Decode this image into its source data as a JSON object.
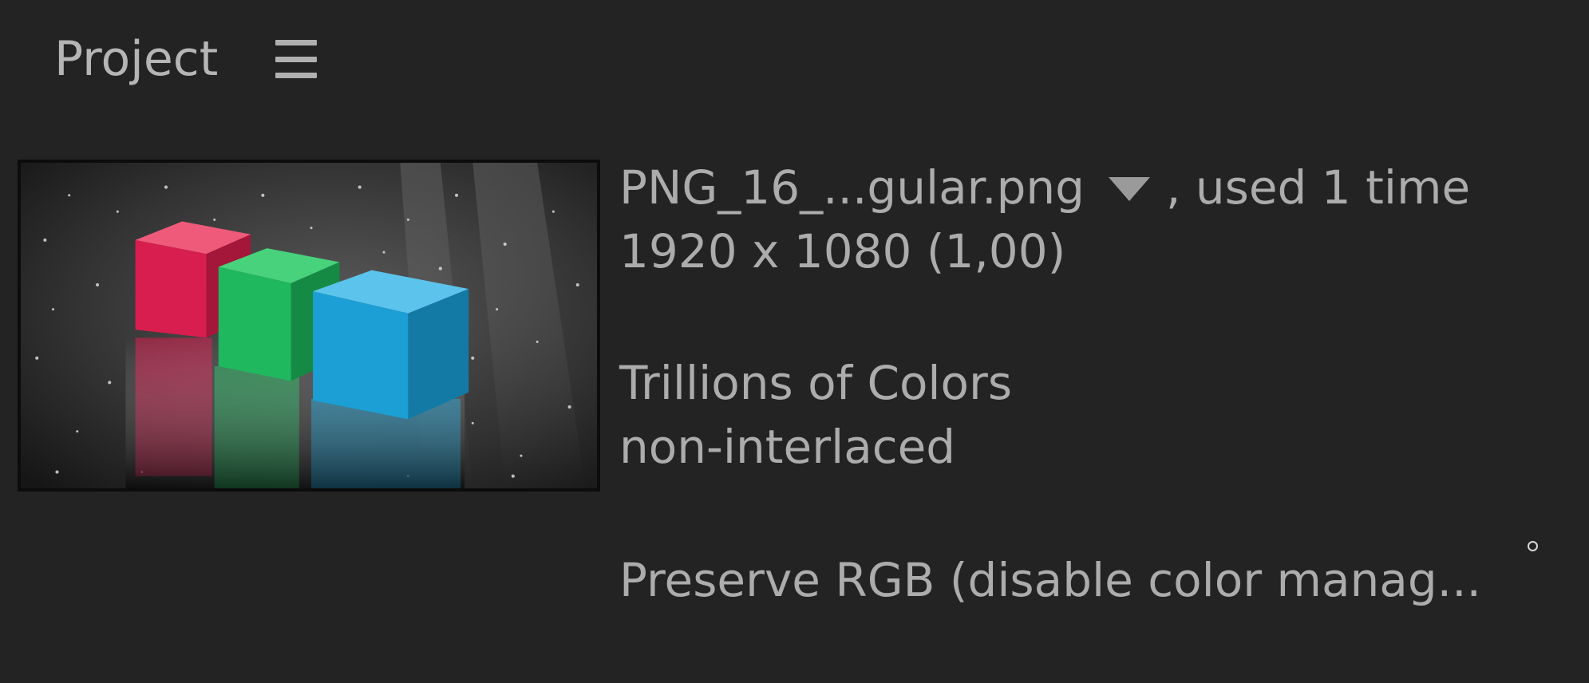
{
  "panel": {
    "title": "Project",
    "menu_icon": "hamburger-menu-icon"
  },
  "asset": {
    "filename": "PNG_16_...gular.png",
    "usage": ", used 1 time",
    "dimensions": "1920 x 1080 (1,00)",
    "color_depth": "Trillions of Colors",
    "interlace": "non-interlaced",
    "color_management": "Preserve RGB (disable color manag..."
  },
  "thumbnail": {
    "cube_colors": [
      "#d81e4e",
      "#1fb85e",
      "#1b9fd4"
    ]
  }
}
